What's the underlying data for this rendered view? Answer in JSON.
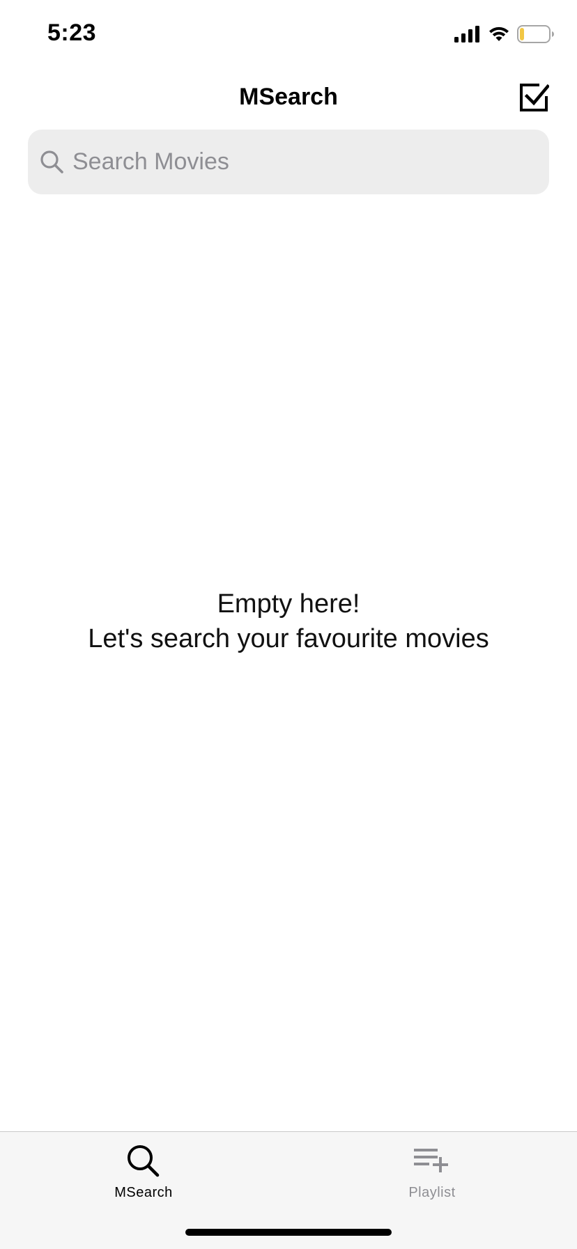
{
  "status_bar": {
    "time": "5:23",
    "icons": [
      "cellular-signal-icon",
      "wifi-icon",
      "battery-icon"
    ],
    "battery_level": 0.15
  },
  "nav": {
    "title": "MSearch",
    "action_icon": "checkbox-checked-icon"
  },
  "search": {
    "placeholder": "Search Movies",
    "value": "",
    "icon": "search-icon"
  },
  "empty_state": {
    "line1": "Empty here!",
    "line2": "Let's search your favourite movies"
  },
  "tab_bar": {
    "tabs": [
      {
        "label": "MSearch",
        "icon": "search-icon",
        "active": true
      },
      {
        "label": "Playlist",
        "icon": "playlist-add-icon",
        "active": false
      }
    ]
  },
  "colors": {
    "active_tab": "#000000",
    "inactive_tab": "#8e8e93",
    "search_bg": "#ededed",
    "battery_fill": "#f2c744"
  }
}
